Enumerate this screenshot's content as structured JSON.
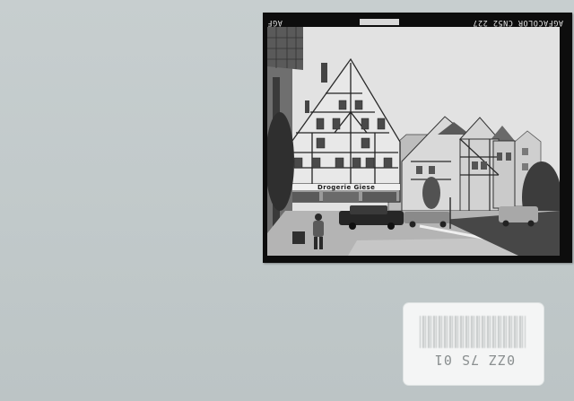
{
  "scene": {
    "description_kind": "scanned vintage black-and-white photograph on a grey-blue background with a small white label"
  },
  "print": {
    "edge_code": "AGFACOLOR CN52 227",
    "edge_left": "AGF"
  },
  "photo": {
    "shop_sign": "Drogerie Giese"
  },
  "label": {
    "code": "0ZZ 7S 01"
  },
  "colors": {
    "background": "#c3cacc",
    "print_border": "#0d0d0d",
    "label": "#f4f5f5"
  }
}
